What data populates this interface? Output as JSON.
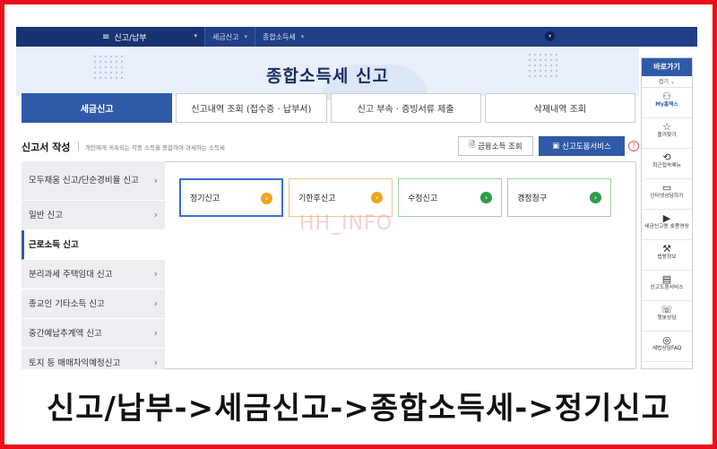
{
  "topbar": {
    "menu_label": "신고/납부",
    "crumbs": [
      "세금신고",
      "종합소득세"
    ]
  },
  "banner": {
    "title": "종합소득세 신고"
  },
  "tabs": [
    {
      "label": "세금신고",
      "active": true
    },
    {
      "label": "신고내역 조회 (접수증 · 납부서)",
      "active": false
    },
    {
      "label": "신고 부속 · 증빙서류 제출",
      "active": false
    },
    {
      "label": "삭제내역 조회",
      "active": false
    }
  ],
  "section": {
    "title": "신고서 작성",
    "desc": "개인에게 귀속되는 각종 소득을 종합하여 과세하는 소득세",
    "btn_financial": "금융소득 조회",
    "btn_help": "신고도움서비스",
    "help_mark": "?"
  },
  "leftmenu": [
    {
      "label": "모두채움 신고/단순경비율 신고",
      "active": false
    },
    {
      "label": "일반 신고",
      "active": false
    },
    {
      "label": "근로소득 신고",
      "active": true
    },
    {
      "label": "분리과세 주택임대 신고",
      "active": false
    },
    {
      "label": "종교인 기타소득 신고",
      "active": false
    },
    {
      "label": "중간예납추계액 신고",
      "active": false
    },
    {
      "label": "토지 등 매매차익예정신고",
      "active": false
    }
  ],
  "cards": [
    {
      "label": "정기신고",
      "state": "selected",
      "color": "#f0a520"
    },
    {
      "label": "기한후신고",
      "state": "orange",
      "color": "#f0a520"
    },
    {
      "label": "수정신고",
      "state": "green",
      "color": "#2b9a4a"
    },
    {
      "label": "경정청구",
      "state": "green",
      "color": "#2b9a4a"
    }
  ],
  "watermark": "HH_INFO",
  "rpanel": {
    "head": "바로가기",
    "fold": "접기 ⌄",
    "items": [
      {
        "label": "My홈택스",
        "icon": "person-icon"
      },
      {
        "label": "즐겨찾기",
        "icon": "star-icon"
      },
      {
        "label": "최근접속메뉴",
        "icon": "history-icon"
      },
      {
        "label": "인터넷상담하기",
        "icon": "monitor-icon"
      },
      {
        "label": "세금신고용 숏폼영상",
        "icon": "play-icon"
      },
      {
        "label": "법령정보",
        "icon": "gavel-icon"
      },
      {
        "label": "신고도움서비스",
        "icon": "book-icon"
      },
      {
        "label": "챗봇상담",
        "icon": "chat-icon"
      },
      {
        "label": "세법상담FAQ",
        "icon": "faq-icon"
      }
    ]
  },
  "caption": "신고/납부->세금신고->종합소득세->정기신고",
  "colors": {
    "frame": "#e8101a",
    "primary": "#2f5aa8",
    "topbar": "#1f3f86"
  }
}
